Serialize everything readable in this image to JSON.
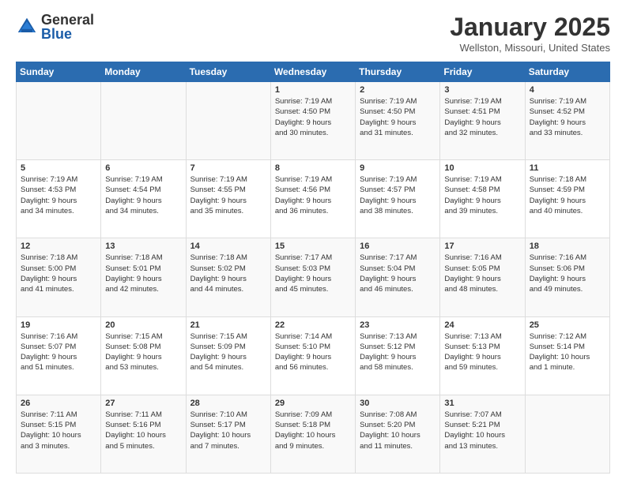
{
  "header": {
    "logo_general": "General",
    "logo_blue": "Blue",
    "month_title": "January 2025",
    "location": "Wellston, Missouri, United States"
  },
  "days_of_week": [
    "Sunday",
    "Monday",
    "Tuesday",
    "Wednesday",
    "Thursday",
    "Friday",
    "Saturday"
  ],
  "weeks": [
    [
      {
        "day": "",
        "info": ""
      },
      {
        "day": "",
        "info": ""
      },
      {
        "day": "",
        "info": ""
      },
      {
        "day": "1",
        "info": "Sunrise: 7:19 AM\nSunset: 4:50 PM\nDaylight: 9 hours\nand 30 minutes."
      },
      {
        "day": "2",
        "info": "Sunrise: 7:19 AM\nSunset: 4:50 PM\nDaylight: 9 hours\nand 31 minutes."
      },
      {
        "day": "3",
        "info": "Sunrise: 7:19 AM\nSunset: 4:51 PM\nDaylight: 9 hours\nand 32 minutes."
      },
      {
        "day": "4",
        "info": "Sunrise: 7:19 AM\nSunset: 4:52 PM\nDaylight: 9 hours\nand 33 minutes."
      }
    ],
    [
      {
        "day": "5",
        "info": "Sunrise: 7:19 AM\nSunset: 4:53 PM\nDaylight: 9 hours\nand 34 minutes."
      },
      {
        "day": "6",
        "info": "Sunrise: 7:19 AM\nSunset: 4:54 PM\nDaylight: 9 hours\nand 34 minutes."
      },
      {
        "day": "7",
        "info": "Sunrise: 7:19 AM\nSunset: 4:55 PM\nDaylight: 9 hours\nand 35 minutes."
      },
      {
        "day": "8",
        "info": "Sunrise: 7:19 AM\nSunset: 4:56 PM\nDaylight: 9 hours\nand 36 minutes."
      },
      {
        "day": "9",
        "info": "Sunrise: 7:19 AM\nSunset: 4:57 PM\nDaylight: 9 hours\nand 38 minutes."
      },
      {
        "day": "10",
        "info": "Sunrise: 7:19 AM\nSunset: 4:58 PM\nDaylight: 9 hours\nand 39 minutes."
      },
      {
        "day": "11",
        "info": "Sunrise: 7:18 AM\nSunset: 4:59 PM\nDaylight: 9 hours\nand 40 minutes."
      }
    ],
    [
      {
        "day": "12",
        "info": "Sunrise: 7:18 AM\nSunset: 5:00 PM\nDaylight: 9 hours\nand 41 minutes."
      },
      {
        "day": "13",
        "info": "Sunrise: 7:18 AM\nSunset: 5:01 PM\nDaylight: 9 hours\nand 42 minutes."
      },
      {
        "day": "14",
        "info": "Sunrise: 7:18 AM\nSunset: 5:02 PM\nDaylight: 9 hours\nand 44 minutes."
      },
      {
        "day": "15",
        "info": "Sunrise: 7:17 AM\nSunset: 5:03 PM\nDaylight: 9 hours\nand 45 minutes."
      },
      {
        "day": "16",
        "info": "Sunrise: 7:17 AM\nSunset: 5:04 PM\nDaylight: 9 hours\nand 46 minutes."
      },
      {
        "day": "17",
        "info": "Sunrise: 7:16 AM\nSunset: 5:05 PM\nDaylight: 9 hours\nand 48 minutes."
      },
      {
        "day": "18",
        "info": "Sunrise: 7:16 AM\nSunset: 5:06 PM\nDaylight: 9 hours\nand 49 minutes."
      }
    ],
    [
      {
        "day": "19",
        "info": "Sunrise: 7:16 AM\nSunset: 5:07 PM\nDaylight: 9 hours\nand 51 minutes."
      },
      {
        "day": "20",
        "info": "Sunrise: 7:15 AM\nSunset: 5:08 PM\nDaylight: 9 hours\nand 53 minutes."
      },
      {
        "day": "21",
        "info": "Sunrise: 7:15 AM\nSunset: 5:09 PM\nDaylight: 9 hours\nand 54 minutes."
      },
      {
        "day": "22",
        "info": "Sunrise: 7:14 AM\nSunset: 5:10 PM\nDaylight: 9 hours\nand 56 minutes."
      },
      {
        "day": "23",
        "info": "Sunrise: 7:13 AM\nSunset: 5:12 PM\nDaylight: 9 hours\nand 58 minutes."
      },
      {
        "day": "24",
        "info": "Sunrise: 7:13 AM\nSunset: 5:13 PM\nDaylight: 9 hours\nand 59 minutes."
      },
      {
        "day": "25",
        "info": "Sunrise: 7:12 AM\nSunset: 5:14 PM\nDaylight: 10 hours\nand 1 minute."
      }
    ],
    [
      {
        "day": "26",
        "info": "Sunrise: 7:11 AM\nSunset: 5:15 PM\nDaylight: 10 hours\nand 3 minutes."
      },
      {
        "day": "27",
        "info": "Sunrise: 7:11 AM\nSunset: 5:16 PM\nDaylight: 10 hours\nand 5 minutes."
      },
      {
        "day": "28",
        "info": "Sunrise: 7:10 AM\nSunset: 5:17 PM\nDaylight: 10 hours\nand 7 minutes."
      },
      {
        "day": "29",
        "info": "Sunrise: 7:09 AM\nSunset: 5:18 PM\nDaylight: 10 hours\nand 9 minutes."
      },
      {
        "day": "30",
        "info": "Sunrise: 7:08 AM\nSunset: 5:20 PM\nDaylight: 10 hours\nand 11 minutes."
      },
      {
        "day": "31",
        "info": "Sunrise: 7:07 AM\nSunset: 5:21 PM\nDaylight: 10 hours\nand 13 minutes."
      },
      {
        "day": "",
        "info": ""
      }
    ]
  ]
}
